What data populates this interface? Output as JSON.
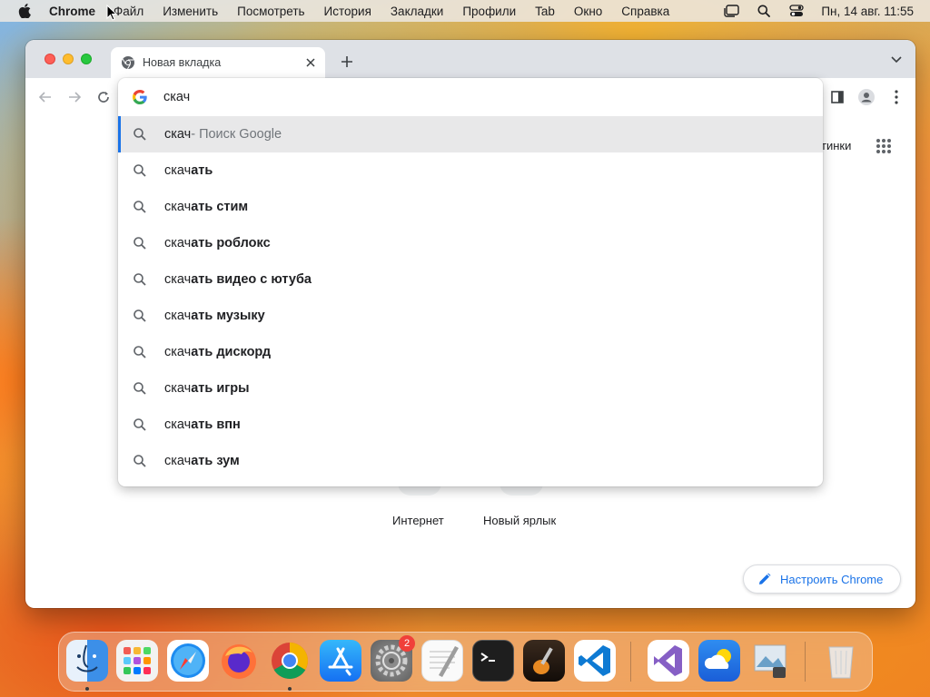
{
  "menubar": {
    "app_name": "Chrome",
    "items": [
      "Файл",
      "Изменить",
      "Посмотреть",
      "История",
      "Закладки",
      "Профили",
      "Tab",
      "Окно",
      "Справка"
    ],
    "clock": "Пн, 14 авг.  11:55"
  },
  "browser": {
    "tab_title": "Новая вкладка",
    "omnibox_query": "скач",
    "suggestions": [
      {
        "query": "скач",
        "completion": "",
        "source": " - Поиск Google",
        "selected": true
      },
      {
        "query": "скач",
        "completion": "ать",
        "source": ""
      },
      {
        "query": "скач",
        "completion": "ать стим",
        "source": ""
      },
      {
        "query": "скач",
        "completion": "ать роблокс",
        "source": ""
      },
      {
        "query": "скач",
        "completion": "ать видео с ютуба",
        "source": ""
      },
      {
        "query": "скач",
        "completion": "ать музыку",
        "source": ""
      },
      {
        "query": "скач",
        "completion": "ать дискорд",
        "source": ""
      },
      {
        "query": "скач",
        "completion": "ать игры",
        "source": ""
      },
      {
        "query": "скач",
        "completion": "ать впн",
        "source": ""
      },
      {
        "query": "скач",
        "completion": "ать зум",
        "source": ""
      }
    ]
  },
  "ntp": {
    "images_link_partial": "тинки",
    "shortcuts": [
      "Интернет",
      "Новый ярлык"
    ],
    "customize_label": "Настроить Chrome"
  },
  "dock": {
    "icons": [
      "finder-icon",
      "launchpad-icon",
      "safari-icon",
      "firefox-icon",
      "chrome-icon",
      "app-store-icon",
      "system-settings-icon",
      "textedit-icon",
      "terminal-icon",
      "garageband-icon",
      "vscode-icon",
      "visual-studio-icon",
      "weather-icon",
      "preview-icon",
      "trash-icon"
    ],
    "settings_badge": "2"
  },
  "colors": {
    "accent_blue": "#1a73e8",
    "tab_strip": "#dee1e6",
    "selected_row": "#e8e8e9"
  }
}
